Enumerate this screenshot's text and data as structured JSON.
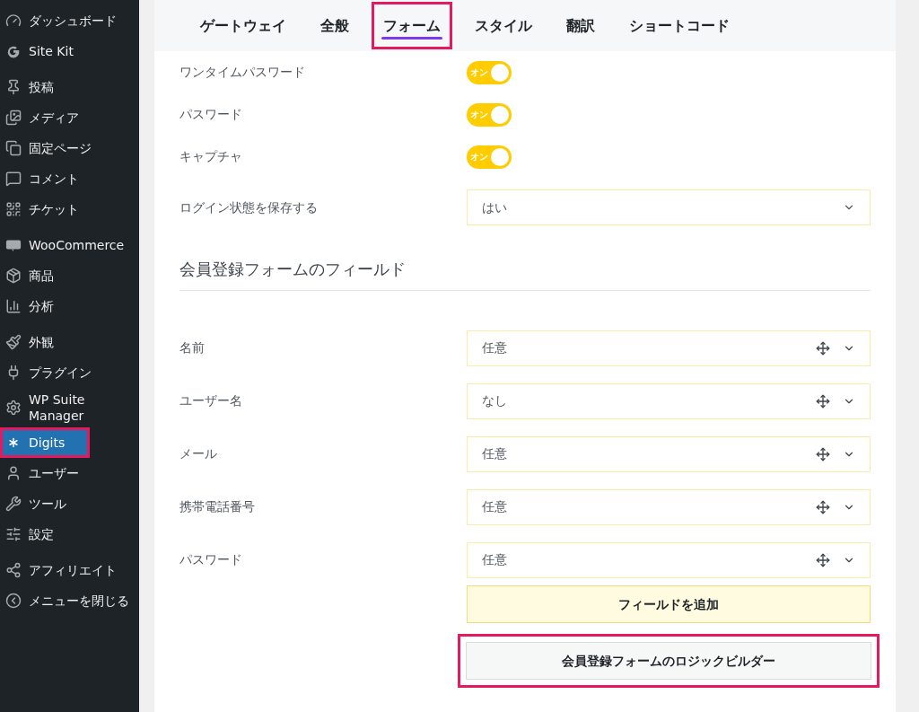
{
  "sidebar": {
    "groups": [
      {
        "items": [
          {
            "kind": "dashboard",
            "label": "ダッシュボード",
            "selected": false,
            "highlighted": false
          },
          {
            "kind": "g",
            "label": "Site Kit",
            "selected": false,
            "highlighted": false
          }
        ]
      },
      {
        "items": [
          {
            "kind": "pin",
            "label": "投稿",
            "selected": false,
            "highlighted": false
          },
          {
            "kind": "media",
            "label": "メディア",
            "selected": false,
            "highlighted": false
          },
          {
            "kind": "pages",
            "label": "固定ページ",
            "selected": false,
            "highlighted": false
          },
          {
            "kind": "comment",
            "label": "コメント",
            "selected": false,
            "highlighted": false
          },
          {
            "kind": "ticket",
            "label": "チケット",
            "selected": false,
            "highlighted": false
          }
        ]
      },
      {
        "items": [
          {
            "kind": "woo",
            "label": "WooCommerce",
            "selected": false,
            "highlighted": false
          },
          {
            "kind": "box",
            "label": "商品",
            "selected": false,
            "highlighted": false
          },
          {
            "kind": "chart",
            "label": "分析",
            "selected": false,
            "highlighted": false
          }
        ]
      },
      {
        "items": [
          {
            "kind": "brush",
            "label": "外観",
            "selected": false,
            "highlighted": false
          },
          {
            "kind": "plug",
            "label": "プラグイン",
            "selected": false,
            "highlighted": false
          },
          {
            "kind": "gear",
            "label": "WP Suite Manager",
            "selected": false,
            "highlighted": false
          },
          {
            "kind": "asterisk",
            "label": "Digits",
            "selected": true,
            "highlighted": true
          },
          {
            "kind": "user",
            "label": "ユーザー",
            "selected": false,
            "highlighted": false
          },
          {
            "kind": "wrench",
            "label": "ツール",
            "selected": false,
            "highlighted": false
          },
          {
            "kind": "sliders",
            "label": "設定",
            "selected": false,
            "highlighted": false
          }
        ]
      },
      {
        "items": [
          {
            "kind": "share",
            "label": "アフィリエイト",
            "selected": false,
            "highlighted": false
          },
          {
            "kind": "collapse",
            "label": "メニューを閉じる",
            "selected": false,
            "highlighted": false
          }
        ]
      }
    ]
  },
  "tabs": [
    {
      "label": "ゲートウェイ",
      "selected": false,
      "highlighted": false
    },
    {
      "label": "全般",
      "selected": false,
      "highlighted": false
    },
    {
      "label": "フォーム",
      "selected": true,
      "highlighted": true
    },
    {
      "label": "スタイル",
      "selected": false,
      "highlighted": false
    },
    {
      "label": "翻訳",
      "selected": false,
      "highlighted": false
    },
    {
      "label": "ショートコード",
      "selected": false,
      "highlighted": false
    }
  ],
  "settings": [
    {
      "kind": "toggle",
      "label": "ワンタイムパスワード",
      "on": true,
      "toggle_text": "オン"
    },
    {
      "kind": "toggle",
      "label": "パスワード",
      "on": true,
      "toggle_text": "オン"
    },
    {
      "kind": "toggle",
      "label": "キャプチャ",
      "on": true,
      "toggle_text": "オン"
    },
    {
      "kind": "select",
      "label": "ログイン状態を保存する",
      "value": "はい"
    }
  ],
  "section_title": "会員登録フォームのフィールド",
  "fields": [
    {
      "label": "名前",
      "value": "任意"
    },
    {
      "label": "ユーザー名",
      "value": "なし"
    },
    {
      "label": "メール",
      "value": "任意"
    },
    {
      "label": "携帯電話番号",
      "value": "任意"
    },
    {
      "label": "パスワード",
      "value": "任意"
    }
  ],
  "buttons": [
    {
      "kind": "add",
      "label": "フィールドを追加",
      "highlighted": false
    },
    {
      "kind": "builder",
      "label": "会員登録フォームのロジックビルダー",
      "highlighted": true
    }
  ]
}
